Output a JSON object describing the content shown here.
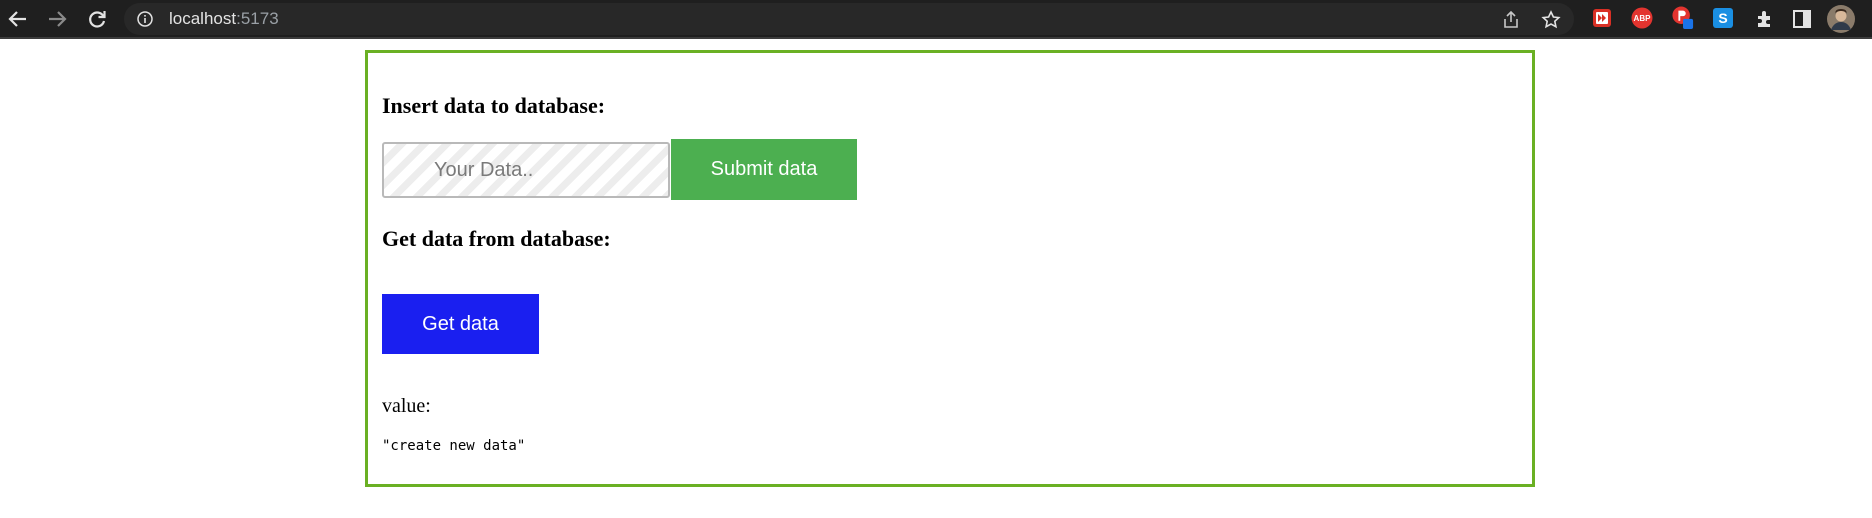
{
  "browser": {
    "url_host": "localhost",
    "url_port": ":5173",
    "icons": [
      "back-icon",
      "forward-icon",
      "reload-icon",
      "info-icon",
      "share-icon",
      "star-icon",
      "extensions-icon",
      "side-panel-icon",
      "profile-avatar"
    ],
    "extensions": [
      {
        "name": "ext-red-icon",
        "label": ""
      },
      {
        "name": "adblock-icon",
        "label": "ABP"
      },
      {
        "name": "ext-red-badge-icon",
        "label": ""
      },
      {
        "name": "ext-blue-s-icon",
        "label": "S"
      }
    ]
  },
  "page": {
    "insert_heading": "Insert data to database:",
    "input_placeholder": "Your Data..",
    "input_value": "",
    "submit_label": "Submit data",
    "get_heading": "Get data from database:",
    "get_label": "Get data",
    "value_label": "value:",
    "value_text": "\"create new data\""
  },
  "colors": {
    "panel_border": "#6ab023",
    "submit_button": "#4caf50",
    "get_button": "#1a1ff0",
    "toolbar_bg": "#1f1f1f"
  }
}
